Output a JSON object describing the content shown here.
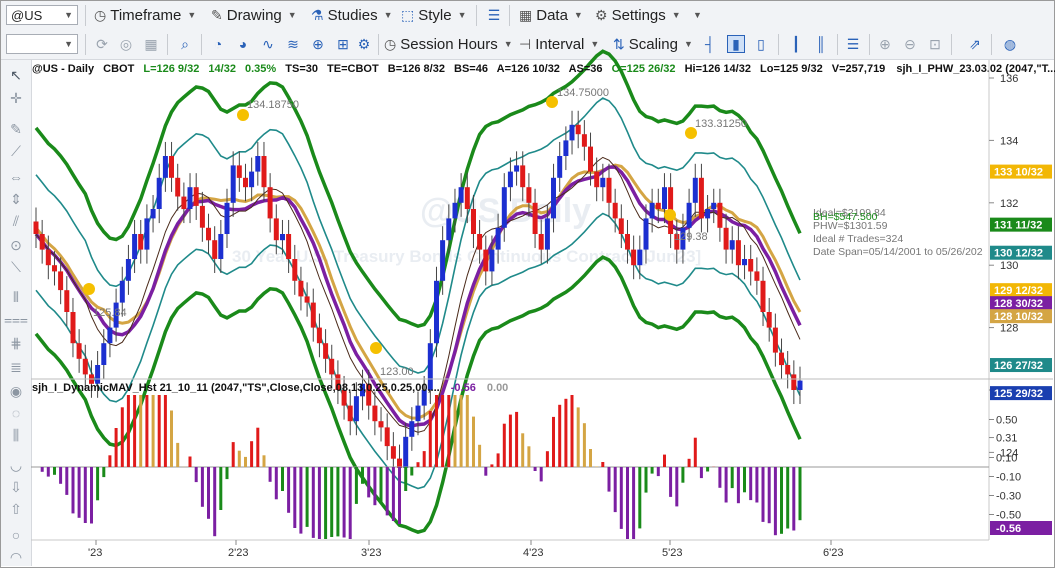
{
  "toolbar1": {
    "symbol": "@US",
    "timeframe": "Timeframe",
    "drawing": "Drawing",
    "studies": "Studies",
    "style": "Style",
    "data": "Data",
    "settings": "Settings"
  },
  "toolbar2": {
    "session_hours": "Session Hours",
    "interval": "Interval",
    "scaling": "Scaling"
  },
  "header_line": {
    "symbol": "@US - Daily",
    "exchange": "CBOT",
    "last": "L=126 9/32",
    "change": "14/32",
    "pct": "0.35%",
    "ts": "TS=30",
    "te": "TE=CBOT",
    "bid": "B=126 8/32",
    "bs": "BS=46",
    "ask": "A=126 10/32",
    "as": "AS=36",
    "open": "O=125 26/32",
    "high": "Hi=126 14/32",
    "low": "Lo=125 9/32",
    "vol": "V=257,719",
    "study": "sjh_I_PHW_23.03.02 (2047,\"T..."
  },
  "watermark": {
    "title": "@US Daily",
    "subtitle": "30 Year U.S. Treasury Bonds Continuous Contract [Jun23]"
  },
  "annotations": {
    "swing1": "134.18750",
    "swing2": "134.75000",
    "swing3": "133.31250",
    "swing4": "125.84",
    "swing5": "123.00",
    "swing6": "129.38",
    "stat1": "Ideal=$2109.84",
    "stat2": "PHW=$1301.59",
    "stat3": "Ideal # Trades=324",
    "stat4": "Date Span=05/14/2001 to 05/26/202",
    "stat5": "BH=$547.500"
  },
  "price_axis": {
    "ticks": [
      "136",
      "134",
      "132",
      "130",
      "128",
      "126",
      "124"
    ],
    "markers": [
      {
        "label": "133 10/32",
        "color": "#f2b705"
      },
      {
        "label": "131 11/32",
        "color": "#1a8a1a"
      },
      {
        "label": "130 12/32",
        "color": "#1f8a8a"
      },
      {
        "label": "129 12/32",
        "color": "#f2b705"
      },
      {
        "label": "128 30/32",
        "color": "#7b1fa2"
      },
      {
        "label": "128 10/32",
        "color": "#d4a544"
      },
      {
        "label": "126 27/32",
        "color": "#1f8a8a"
      },
      {
        "label": "125 29/32",
        "color": "#1a3fb0"
      }
    ]
  },
  "lower_pane": {
    "title": "sjh_I_DynamicMAV_Hst 21_10_11 (2047,\"TS\",Close,Close,08,13,0.25,0.25,00,...",
    "value1": "-0.56",
    "value2": "0.00",
    "ticks": [
      "0.50",
      "0.31",
      "0.10",
      "-0.10",
      "-0.30",
      "-0.50"
    ],
    "marker": "-0.56"
  },
  "time_axis": [
    "'23",
    "2'23",
    "3'23",
    "4'23",
    "5'23",
    "6'23"
  ],
  "chart_data": {
    "type": "candlestick",
    "ylim": [
      122.5,
      137
    ],
    "ohlc_close": [
      131.0,
      130.5,
      130.0,
      129.8,
      129.2,
      128.5,
      127.5,
      127.0,
      126.5,
      126.2,
      126.8,
      127.5,
      128.0,
      128.8,
      129.5,
      130.2,
      131.0,
      130.5,
      131.5,
      131.8,
      132.8,
      133.5,
      132.8,
      132.2,
      131.8,
      132.5,
      131.9,
      131.2,
      130.8,
      130.2,
      131.0,
      132.0,
      133.2,
      132.8,
      132.5,
      133.0,
      133.5,
      132.5,
      131.5,
      130.8,
      131.0,
      130.2,
      129.5,
      129.0,
      128.8,
      128.0,
      127.5,
      127.0,
      126.5,
      126.0,
      125.5,
      125.0,
      125.8,
      126.2,
      125.5,
      125.0,
      124.8,
      124.2,
      123.8,
      123.5,
      124.5,
      125.0,
      125.5,
      126.0,
      127.5,
      129.5,
      130.8,
      131.5,
      132.0,
      132.5,
      131.8,
      131.0,
      130.5,
      129.8,
      130.5,
      131.2,
      132.5,
      133.0,
      133.2,
      132.5,
      132.0,
      131.0,
      130.5,
      131.5,
      132.8,
      133.5,
      134.0,
      134.5,
      134.2,
      133.8,
      133.0,
      132.5,
      132.8,
      132.0,
      131.5,
      131.0,
      130.5,
      130.0,
      130.5,
      131.5,
      132.0,
      131.8,
      132.5,
      131.0,
      130.5,
      131.2,
      132.0,
      132.8,
      131.5,
      131.8,
      132.0,
      131.2,
      130.5,
      130.8,
      130.0,
      130.2,
      129.8,
      129.5,
      128.5,
      128.0,
      127.2,
      126.8,
      126.5,
      126.0,
      126.3
    ],
    "bands": {
      "upper_green": "outer envelope",
      "lower_green": "outer envelope"
    },
    "swing_labels": [
      134.1875,
      134.75,
      133.3125,
      125.84,
      123.0,
      129.38
    ],
    "oscillator_range": [
      -0.56,
      0.75
    ],
    "oscillator_last": -0.56
  }
}
